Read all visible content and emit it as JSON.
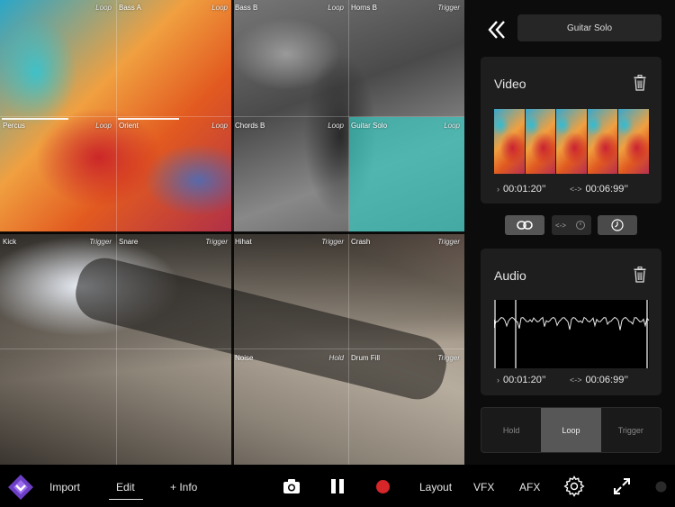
{
  "grid": {
    "cells": [
      {
        "name": "",
        "mode": "Loop"
      },
      {
        "name": "Bass A",
        "mode": "Loop"
      },
      {
        "name": "Bass B",
        "mode": "Loop"
      },
      {
        "name": "Horns B",
        "mode": "Trigger"
      },
      {
        "name": "Percus",
        "mode": "Loop"
      },
      {
        "name": "Orient",
        "mode": "Loop"
      },
      {
        "name": "Chords B",
        "mode": "Loop"
      },
      {
        "name": "Guitar Solo",
        "mode": "Loop"
      },
      {
        "name": "Kick",
        "mode": "Trigger"
      },
      {
        "name": "Snare",
        "mode": "Trigger"
      },
      {
        "name": "Hihat",
        "mode": "Trigger"
      },
      {
        "name": "Crash",
        "mode": "Trigger"
      },
      {
        "name": "",
        "mode": ""
      },
      {
        "name": "",
        "mode": ""
      },
      {
        "name": "Noise",
        "mode": "Hold"
      },
      {
        "name": "Drum Fill",
        "mode": "Trigger"
      }
    ]
  },
  "panel": {
    "clip_title": "Guitar Solo",
    "video": {
      "title": "Video",
      "start": "00:01:20’’",
      "length": "00:06:99’’"
    },
    "audio": {
      "title": "Audio",
      "start": "00:01:20’’",
      "length": "00:06:99’’"
    },
    "play_modes": {
      "options": [
        "Hold",
        "Loop",
        "Trigger"
      ],
      "selected": "Loop"
    }
  },
  "toolbar": {
    "import": "Import",
    "edit": "Edit",
    "info": "+ Info",
    "layout": "Layout",
    "vfx": "VFX",
    "afx": "AFX"
  },
  "colors": {
    "accent": "#6c3fc4",
    "record": "#d6262a",
    "selected_mode": "#575757"
  }
}
